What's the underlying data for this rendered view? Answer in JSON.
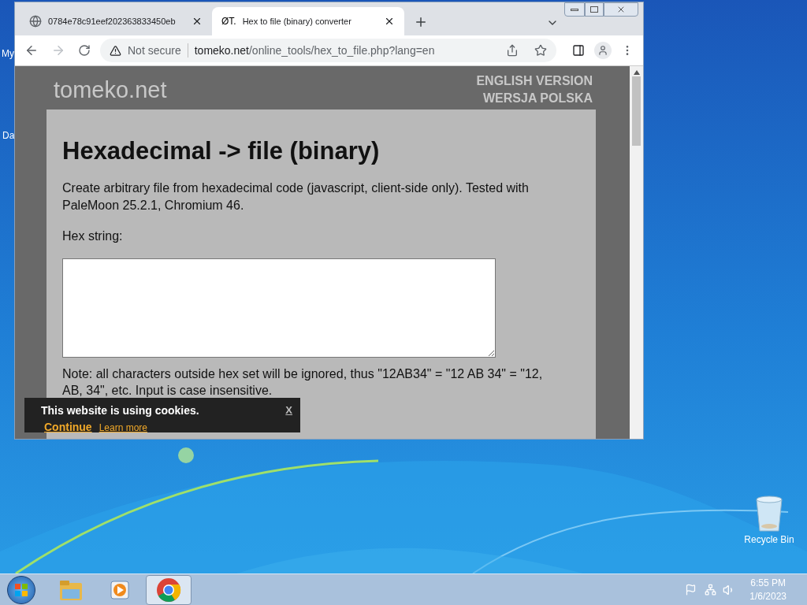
{
  "desktop": {
    "icons": [
      {
        "label": "My"
      },
      {
        "label": "Da"
      },
      {
        "label": "Recycle Bin"
      }
    ]
  },
  "browser": {
    "tabs": [
      {
        "title": "0784e78c91eef202363833450eb",
        "selected": false,
        "kind": "globe"
      },
      {
        "title": "Hex to file (binary) converter",
        "selected": true,
        "kind": "text",
        "favicon_text": "ØT."
      }
    ],
    "address": {
      "security": "Not secure",
      "host": "tomeko.net",
      "path": "/online_tools/hex_to_file.php?lang=en"
    }
  },
  "page": {
    "logo": "tomeko.net",
    "languages": [
      "ENGLISH VERSION",
      "WERSJA POLSKA"
    ],
    "heading": "Hexadecimal -> file (binary)",
    "intro": "Create arbitrary file from hexadecimal code (javascript, client-side only). Tested with PaleMoon 25.2.1, Chromium 46.",
    "hex_label": "Hex string:",
    "note": "Note: all characters outside hex set will be ignored, thus \"12AB34\" = \"12 AB 34\" = \"12, AB, 34\", etc. Input is case insensitive."
  },
  "cookie_banner": {
    "message": "This website is using cookies.",
    "continue": "Continue",
    "learn_more": "Learn more",
    "close": "X"
  },
  "taskbar": {
    "apps": [
      {
        "kind": "explorer",
        "selected": false
      },
      {
        "kind": "media",
        "selected": false
      },
      {
        "kind": "chrome",
        "selected": true
      }
    ],
    "time": "6:55 PM",
    "date": "1/6/2023"
  }
}
